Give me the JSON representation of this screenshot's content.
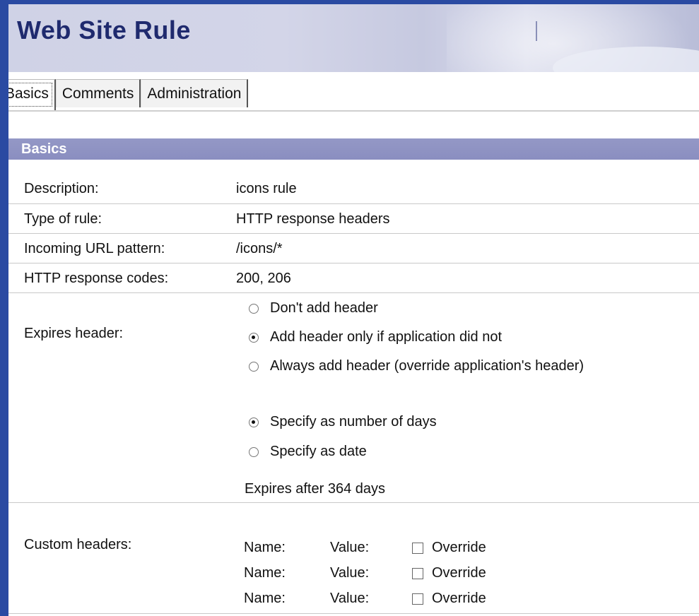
{
  "window": {
    "title": "Web Site Rule"
  },
  "tabs": [
    {
      "label": "Basics",
      "active": true
    },
    {
      "label": "Comments",
      "active": false
    },
    {
      "label": "Administration",
      "active": false
    }
  ],
  "section": {
    "title": "Basics"
  },
  "fields": {
    "description": {
      "label": "Description:",
      "value": "icons rule"
    },
    "type": {
      "label": "Type of rule:",
      "value": "HTTP response headers"
    },
    "url": {
      "label": "Incoming URL pattern:",
      "value": "/icons/*"
    },
    "codes": {
      "label": "HTTP response codes:",
      "value": "200, 206"
    }
  },
  "expires": {
    "label": "Expires header:",
    "options": [
      {
        "label": "Don't add header",
        "selected": false
      },
      {
        "label": "Add header only if application did not",
        "selected": true
      },
      {
        "label": "Always add header (override application's header)",
        "selected": false
      }
    ],
    "mode_options": [
      {
        "label": "Specify as number of days",
        "selected": true
      },
      {
        "label": "Specify as date",
        "selected": false
      }
    ],
    "summary": "Expires after 364 days"
  },
  "custom_headers": {
    "label": "Custom headers:",
    "rows": [
      {
        "name_label": "Name:",
        "value_label": "Value:",
        "override_label": "Override",
        "override": false
      },
      {
        "name_label": "Name:",
        "value_label": "Value:",
        "override_label": "Override",
        "override": false
      },
      {
        "name_label": "Name:",
        "value_label": "Value:",
        "override_label": "Override",
        "override": false
      }
    ]
  },
  "colors": {
    "border": "#2a4aa2",
    "title": "#1f2a6e",
    "section_header": "#8a8ec0"
  }
}
